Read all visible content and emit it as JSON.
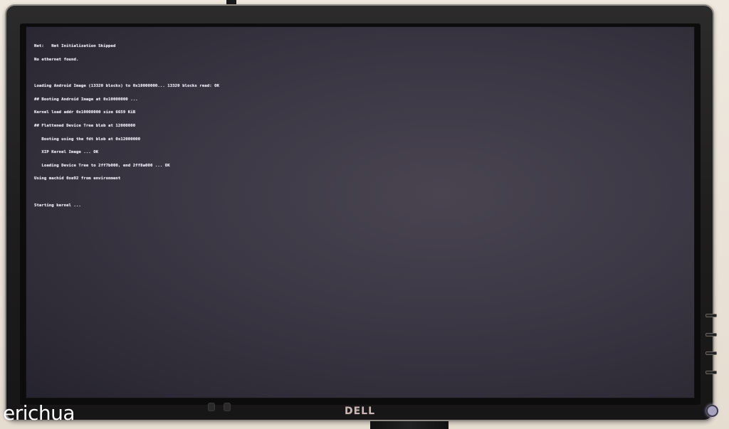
{
  "console_lines": [
    "Net:   Net Initialization Skipped",
    "No ethernet found.",
    "",
    "Loading Android Image (13320 blocks) to 0x10000000... 13320 blocks read: OK",
    "## Booting Android Image at 0x10000000 ...",
    "Kernel load addr 0x10008000 size 6659 KiB",
    "## Flattened Device Tree blob at 12000000",
    "   Booting using the fdt blob at 0x12000000",
    "   XIP Kernel Image ... OK",
    "   Loading Device Tree to 2ff7b000, end 2ff8a000 ... OK",
    "Using machid 0xe92 from environment",
    "",
    "Starting kernel ..."
  ],
  "brand_logo": "DELL",
  "watermark": "erichua"
}
